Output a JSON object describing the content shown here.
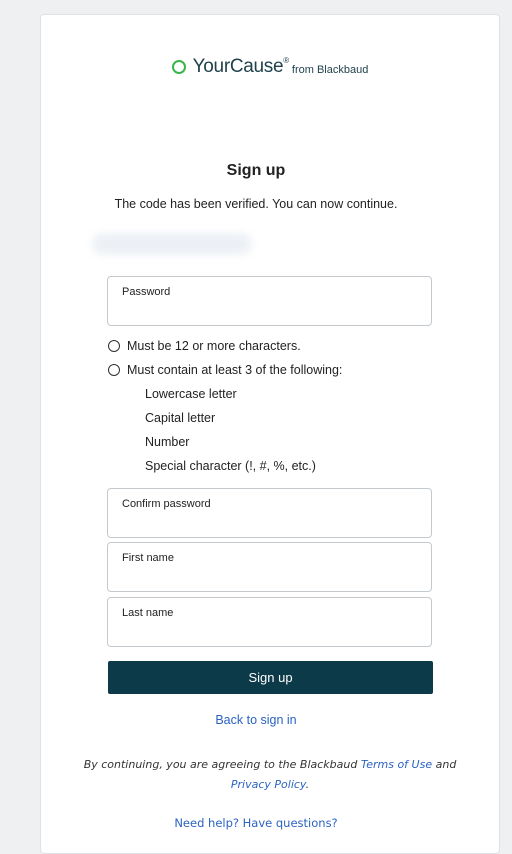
{
  "logo": {
    "brand": "YourCause",
    "registered": "®",
    "suffix": "from Blackbaud",
    "ring_color": "#39b54a"
  },
  "form": {
    "title": "Sign up",
    "message": "The code has been verified. You can now continue.",
    "password_label": "Password",
    "password_rules": [
      "Must be 12 or more characters.",
      "Must contain at least 3 of the following:"
    ],
    "password_subrules": [
      "Lowercase letter",
      "Capital letter",
      "Number",
      "Special character (!, #, %, etc.)"
    ],
    "confirm_label": "Confirm password",
    "first_name_label": "First name",
    "last_name_label": "Last name",
    "submit_label": "Sign up",
    "back_link": "Back to sign in"
  },
  "legal": {
    "prefix": "By continuing, you are agreeing to the Blackbaud",
    "terms_link": "Terms of Use",
    "and": "and",
    "privacy_link": "Privacy Policy",
    "period": "."
  },
  "help_link": "Need help? Have questions?",
  "colors": {
    "button_bg": "#0c3a48",
    "link": "#2b63c2",
    "page_bg": "#eef0f2"
  }
}
